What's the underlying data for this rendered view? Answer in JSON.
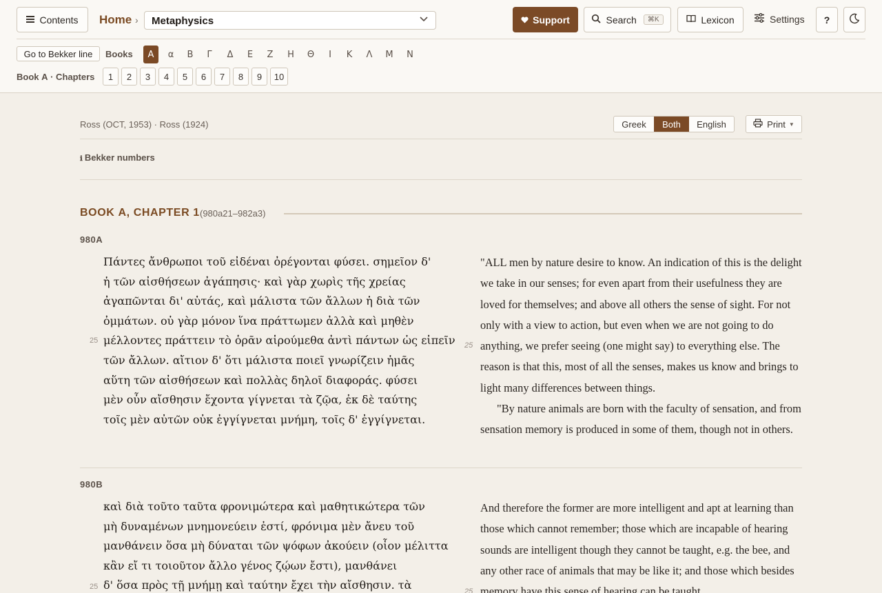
{
  "header": {
    "contents_label": "Contents",
    "home_label": "Home",
    "crumb_sep": "›",
    "work_title": "Metaphysics",
    "support_label": "Support",
    "search_label": "Search",
    "search_shortcut": "⌘K",
    "lexicon_label": "Lexicon",
    "settings_label": "Settings",
    "help_label": "?"
  },
  "nav": {
    "bekker_button": "Go to Bekker line",
    "books_label": "Books",
    "books": [
      "Α",
      "α",
      "Β",
      "Γ",
      "Δ",
      "Ε",
      "Ζ",
      "Η",
      "Θ",
      "Ι",
      "Κ",
      "Λ",
      "Μ",
      "Ν"
    ],
    "active_book": "Α",
    "chapters_label": "Book Α · Chapters",
    "chapters": [
      "1",
      "2",
      "3",
      "4",
      "5",
      "6",
      "7",
      "8",
      "9",
      "10"
    ]
  },
  "toolbar": {
    "edition": "Ross (OCT, 1953) · Ross (1924)",
    "view_options": [
      "Greek",
      "Both",
      "English"
    ],
    "active_view": "Both",
    "print_label": "Print",
    "bekker_numbers_label": "Bekker numbers"
  },
  "chapter": {
    "title": "BOOK Α, CHAPTER 1",
    "range": "(980a21–982a3)"
  },
  "sections": [
    {
      "label": "980A",
      "greek_lines": [
        "Πάντες ἄνθρωποι τοῦ εἰδέναι ὀρέγονται φύσει. σημεῖον δ'",
        "ἡ τῶν αἰσθήσεων ἀγάπησις· καὶ γὰρ χωρὶς τῆς χρείας",
        "ἀγαπῶνται δι' αὑτάς, καὶ μάλιστα τῶν ἄλλων ἡ διὰ τῶν",
        "ὀμμάτων. οὐ γὰρ μόνον ἵνα πράττωμεν ἀλλὰ καὶ μηθὲν",
        "μέλλοντες πράττειν τὸ ὁρᾶν αἱρούμεθα ἀντὶ πάντων ὡς εἰπεῖν",
        "τῶν ἄλλων. αἴτιον δ' ὅτι μάλιστα ποιεῖ γνωρίζειν ἡμᾶς",
        "αὕτη τῶν αἰσθήσεων καὶ πολλὰς δηλοῖ διαφοράς. φύσει",
        "μὲν οὖν αἴσθησιν ἔχοντα γίγνεται τὰ ζῷα, ἐκ δὲ ταύτης",
        "τοῖς μὲν αὐτῶν οὐκ ἐγγίγνεται μνήμη, τοῖς δ' ἐγγίγνεται."
      ],
      "greek_line_number": "25",
      "english_lines": [
        "\"ALL men by nature desire to know. An indication of this is the delight",
        "we take in our senses; for even apart from their usefulness they are",
        "loved for themselves; and above all others the sense of sight. For not",
        "only with a view to action, but even when we are not going to do",
        "anything, we prefer seeing (one might say) to everything else. The",
        "reason is that this, most of all the senses, makes us know and brings to",
        "light many differences between things.",
        "\"By nature animals are born with the faculty of sensation, and from",
        "sensation memory is produced in some of them, though not in others."
      ],
      "english_line_number": "25"
    },
    {
      "label": "980B",
      "greek_lines": [
        "καὶ διὰ τοῦτο ταῦτα φρονιμώτερα καὶ μαθητικώτερα τῶν",
        "μὴ δυναμένων μνημονεύειν ἐστί, φρόνιμα μὲν ἄνευ τοῦ",
        "μανθάνειν ὅσα μὴ δύναται τῶν ψόφων ἀκούειν (οἷον μέλιττα",
        "κἂν εἴ τι τοιοῦτον ἄλλο γένος ζῴων ἔστι), μανθάνει",
        "δ' ὅσα πρὸς τῇ μνήμῃ καὶ ταύτην ἔχει τὴν αἴσθησιν. τὰ"
      ],
      "greek_line_number": "25",
      "english_lines": [
        "And therefore the former are more intelligent and apt at learning than",
        "those which cannot remember; those which are incapable of hearing",
        "sounds are intelligent though they cannot be taught, e.g. the bee, and",
        "any other race of animals that may be like it; and those which besides",
        "memory have this sense of hearing can be taught."
      ],
      "english_line_number": "25"
    }
  ],
  "icons": {
    "contents": "menu-icon",
    "support": "heart-icon",
    "search": "search-icon",
    "lexicon": "book-icon",
    "settings": "sliders-icon",
    "theme": "moon-icon",
    "print": "printer-icon",
    "bekker": "info-icon"
  },
  "colors": {
    "accent": "#7b4a26",
    "background": "#f3efe8",
    "header_bg": "#faf8f4"
  }
}
